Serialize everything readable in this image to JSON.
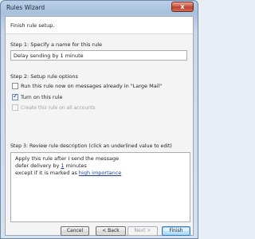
{
  "window": {
    "title": "Rules Wizard",
    "close_glyph": "x"
  },
  "header": {
    "text": "Finish rule setup."
  },
  "step1": {
    "label": "Step 1: Specify a name for this rule",
    "name_value": "Delay sending by 1 minute"
  },
  "step2": {
    "label": "Step 2: Setup rule options",
    "options": [
      {
        "label": "Run this rule now on messages already in \"Large Mail\"",
        "checked": false,
        "enabled": true
      },
      {
        "label": "Turn on this rule",
        "checked": true,
        "enabled": true
      },
      {
        "label": "Create this rule on all accounts",
        "checked": false,
        "enabled": false
      }
    ]
  },
  "step3": {
    "label": "Step 3: Review rule description (click an underlined value to edit)",
    "line1": "Apply this rule after I send the message",
    "line2_prefix": "defer delivery by ",
    "line2_link": "1",
    "line2_suffix": " minutes",
    "line3_prefix": "except if it is marked as ",
    "line3_link": "high importance"
  },
  "buttons": {
    "cancel": "Cancel",
    "back": "< Back",
    "next": "Next >",
    "finish": "Finish"
  }
}
